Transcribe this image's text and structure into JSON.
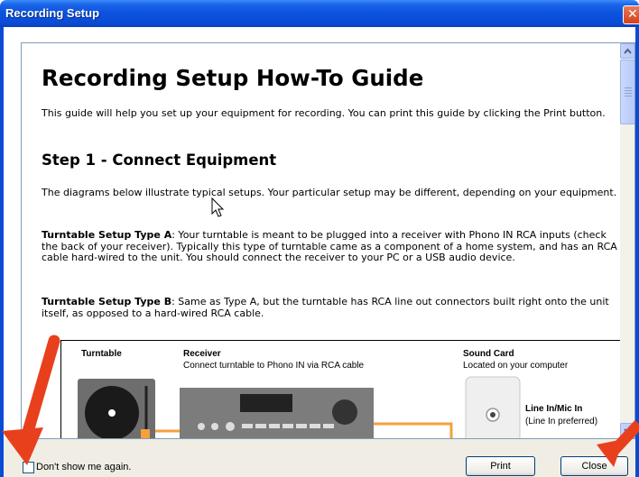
{
  "window": {
    "title": "Recording Setup",
    "close_glyph": "✕"
  },
  "guide": {
    "title": "Recording Setup How-To Guide",
    "intro": "This guide will help you set up your equipment for recording. You can print this guide by clicking the Print button.",
    "step1_heading": "Step 1 - Connect Equipment",
    "diagrams_intro": "The diagrams below illustrate typical setups. Your particular setup may be different, depending on your equipment.",
    "type_a_label": "Turntable Setup Type A",
    "type_a_text": ": Your turntable is meant to be plugged into a receiver with Phono IN RCA inputs (check the back of your receiver). Typically this type of turntable came as a component of a home system, and has an RCA cable hard-wired to the unit. You should connect the receiver to your PC or a USB audio device.",
    "type_b_label": "Turntable Setup Type B",
    "type_b_text": ": Same as Type A, but the turntable has RCA line out connectors built right onto the unit itself, as opposed to a hard-wired RCA cable."
  },
  "diagram": {
    "turntable_label": "Turntable",
    "receiver_label": "Receiver",
    "receiver_caption": "Connect turntable to Phono IN via RCA cable",
    "soundcard_label": "Sound Card",
    "soundcard_caption": "Located on your computer",
    "linein_label": "Line In/Mic In",
    "linein_caption": "(Line In preferred)"
  },
  "footer": {
    "dont_show_label": "Don't show me again.",
    "dont_show_checked": false,
    "print_label": "Print",
    "close_label": "Close"
  },
  "colors": {
    "titlebar": "#0a52de",
    "annotation_arrow": "#e8401c",
    "cable": "#f5a03c",
    "device_gray": "#7c7c7c"
  }
}
